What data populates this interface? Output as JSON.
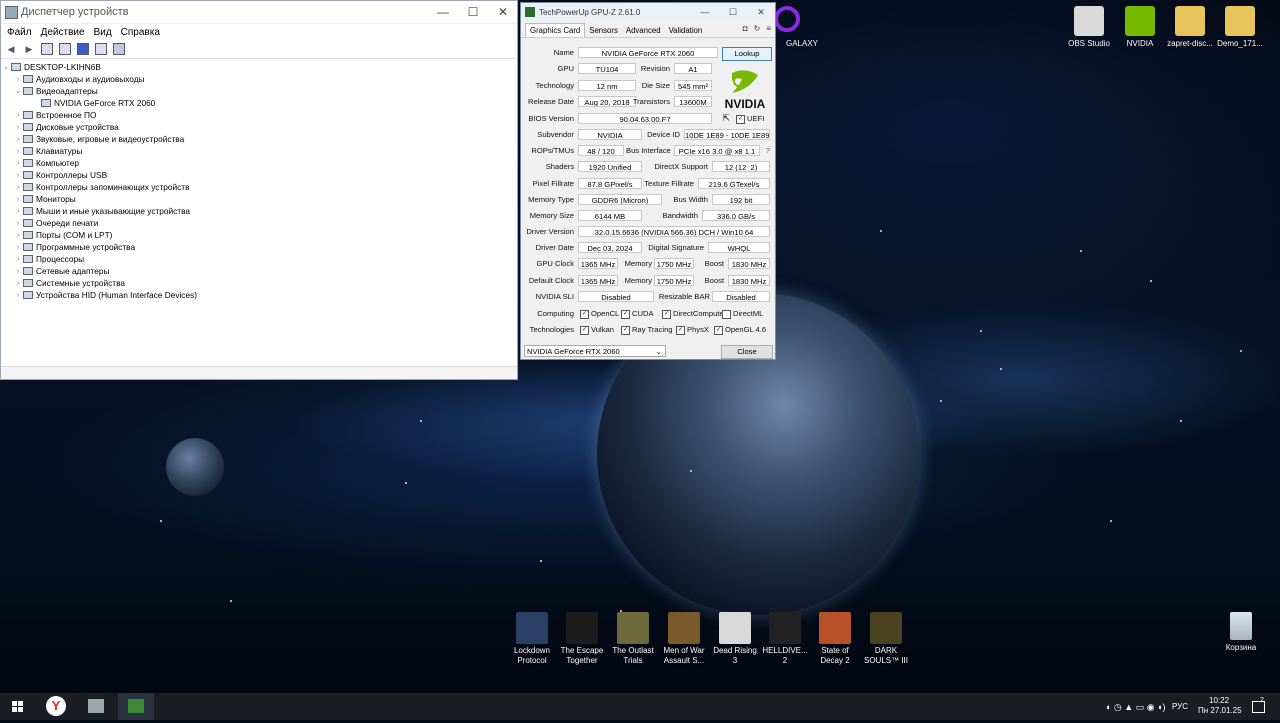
{
  "desktop": {
    "icons_top": [
      {
        "label": "OBS Studio",
        "color": "#d9d9d9"
      },
      {
        "label": "NVIDIA",
        "color": "#76b900"
      },
      {
        "label": "zapret-disc...",
        "color": "#e8c55a"
      },
      {
        "label": "Demo_171...",
        "color": "#e8c55a"
      }
    ],
    "galaxy_label": "GALAXY",
    "recycle_bin": "Корзина",
    "games": [
      {
        "label": "Lockdown Protocol",
        "color": "#2a3f66"
      },
      {
        "label": "The Escape Together",
        "color": "#1c1c1c"
      },
      {
        "label": "The Outlast Trials",
        "color": "#6c6a3a"
      },
      {
        "label": "Men of War Assault S...",
        "color": "#7a5a2a"
      },
      {
        "label": "Dead Rising 3",
        "color": "#d9d9d9"
      },
      {
        "label": "HELLDIVE... 2",
        "color": "#222222"
      },
      {
        "label": "State of Decay 2",
        "color": "#b8502a"
      },
      {
        "label": "DARK SOULS™ III",
        "color": "#4a4220"
      }
    ]
  },
  "devmgr": {
    "title": "Диспетчер устройств",
    "menu": [
      "Файл",
      "Действие",
      "Вид",
      "Справка"
    ],
    "root": "DESKTOP-LKIHN6B",
    "tree": [
      {
        "label": "Аудиовходы и аудиовыходы",
        "expanded": false,
        "level": 1
      },
      {
        "label": "Видеоадаптеры",
        "expanded": true,
        "level": 1
      },
      {
        "label": "NVIDIA GeForce RTX 2060",
        "expanded": null,
        "level": 2
      },
      {
        "label": "Встроенное ПО",
        "expanded": false,
        "level": 1
      },
      {
        "label": "Дисковые устройства",
        "expanded": false,
        "level": 1
      },
      {
        "label": "Звуковые, игровые и видеоустройства",
        "expanded": false,
        "level": 1
      },
      {
        "label": "Клавиатуры",
        "expanded": false,
        "level": 1
      },
      {
        "label": "Компьютер",
        "expanded": false,
        "level": 1
      },
      {
        "label": "Контроллеры USB",
        "expanded": false,
        "level": 1
      },
      {
        "label": "Контроллеры запоминающих устройств",
        "expanded": false,
        "level": 1
      },
      {
        "label": "Мониторы",
        "expanded": false,
        "level": 1
      },
      {
        "label": "Мыши и иные указывающие устройства",
        "expanded": false,
        "level": 1
      },
      {
        "label": "Очереди печати",
        "expanded": false,
        "level": 1
      },
      {
        "label": "Порты (COM и LPT)",
        "expanded": false,
        "level": 1
      },
      {
        "label": "Программные устройства",
        "expanded": false,
        "level": 1
      },
      {
        "label": "Процессоры",
        "expanded": false,
        "level": 1
      },
      {
        "label": "Сетевые адаптеры",
        "expanded": false,
        "level": 1
      },
      {
        "label": "Системные устройства",
        "expanded": false,
        "level": 1
      },
      {
        "label": "Устройства HID (Human Interface Devices)",
        "expanded": false,
        "level": 1
      }
    ]
  },
  "gpuz": {
    "title": "TechPowerUp GPU-Z 2.61.0",
    "tabs": [
      "Graphics Card",
      "Sensors",
      "Advanced",
      "Validation"
    ],
    "lookup": "Lookup",
    "labels": {
      "name": "Name",
      "gpu": "GPU",
      "revision": "Revision",
      "technology": "Technology",
      "die_size": "Die Size",
      "release_date": "Release Date",
      "transistors": "Transistors",
      "bios_version": "BIOS Version",
      "uefi": "UEFI",
      "subvendor": "Subvendor",
      "device_id": "Device ID",
      "rops_tmus": "ROPs/TMUs",
      "bus_interface": "Bus Interface",
      "shaders": "Shaders",
      "directx_support": "DirectX Support",
      "pixel_fillrate": "Pixel Fillrate",
      "texture_fillrate": "Texture Fillrate",
      "memory_type": "Memory Type",
      "bus_width": "Bus Width",
      "memory_size": "Memory Size",
      "bandwidth": "Bandwidth",
      "driver_version": "Driver Version",
      "driver_date": "Driver Date",
      "digital_signature": "Digital Signature",
      "gpu_clock": "GPU Clock",
      "memory": "Memory",
      "boost": "Boost",
      "default_clock": "Default Clock",
      "nvidia_sli": "NVIDIA SLI",
      "resizable_bar": "Resizable BAR",
      "computing": "Computing",
      "technologies": "Technologies"
    },
    "values": {
      "name": "NVIDIA GeForce RTX 2060",
      "gpu": "TU104",
      "revision": "A1",
      "technology": "12 nm",
      "die_size": "545 mm²",
      "release_date": "Aug 20, 2018",
      "transistors": "13600M",
      "bios_version": "90.04.63.00.F7",
      "subvendor": "NVIDIA",
      "device_id": "10DE 1E89 - 10DE 1E89",
      "rops_tmus": "48 / 120",
      "bus_interface": "PCIe x16 3.0 @ x8 1.1",
      "bus_help": "?",
      "shaders": "1920 Unified",
      "directx_support": "12 (12_2)",
      "pixel_fillrate": "87.8 GPixel/s",
      "texture_fillrate": "219.6 GTexel/s",
      "memory_type": "GDDR6 (Micron)",
      "bus_width": "192 bit",
      "memory_size": "6144 MB",
      "bandwidth": "336.0 GB/s",
      "driver_version": "32.0.15.6636 (NVIDIA 566.36) DCH / Win10 64",
      "driver_date": "Dec 03, 2024",
      "digital_signature": "WHQL",
      "gpu_clock": "1365 MHz",
      "gpu_memory": "1750 MHz",
      "gpu_boost": "1830 MHz",
      "default_clock": "1365 MHz",
      "default_memory": "1750 MHz",
      "default_boost": "1830 MHz",
      "nvidia_sli": "Disabled",
      "resizable_bar": "Disabled"
    },
    "computing": [
      {
        "label": "OpenCL",
        "checked": true
      },
      {
        "label": "CUDA",
        "checked": true
      },
      {
        "label": "DirectCompute",
        "checked": true
      },
      {
        "label": "DirectML",
        "checked": false
      }
    ],
    "technologies": [
      {
        "label": "Vulkan",
        "checked": true
      },
      {
        "label": "Ray Tracing",
        "checked": true
      },
      {
        "label": "PhysX",
        "checked": true
      },
      {
        "label": "OpenGL 4.6",
        "checked": true
      }
    ],
    "logo_text": "NVIDIA",
    "selected_gpu": "NVIDIA GeForce RTX 2060",
    "close": "Close"
  },
  "taskbar": {
    "language": "РУС",
    "time": "10:22",
    "date": "Пн 27.01.25",
    "notifications": "2"
  }
}
